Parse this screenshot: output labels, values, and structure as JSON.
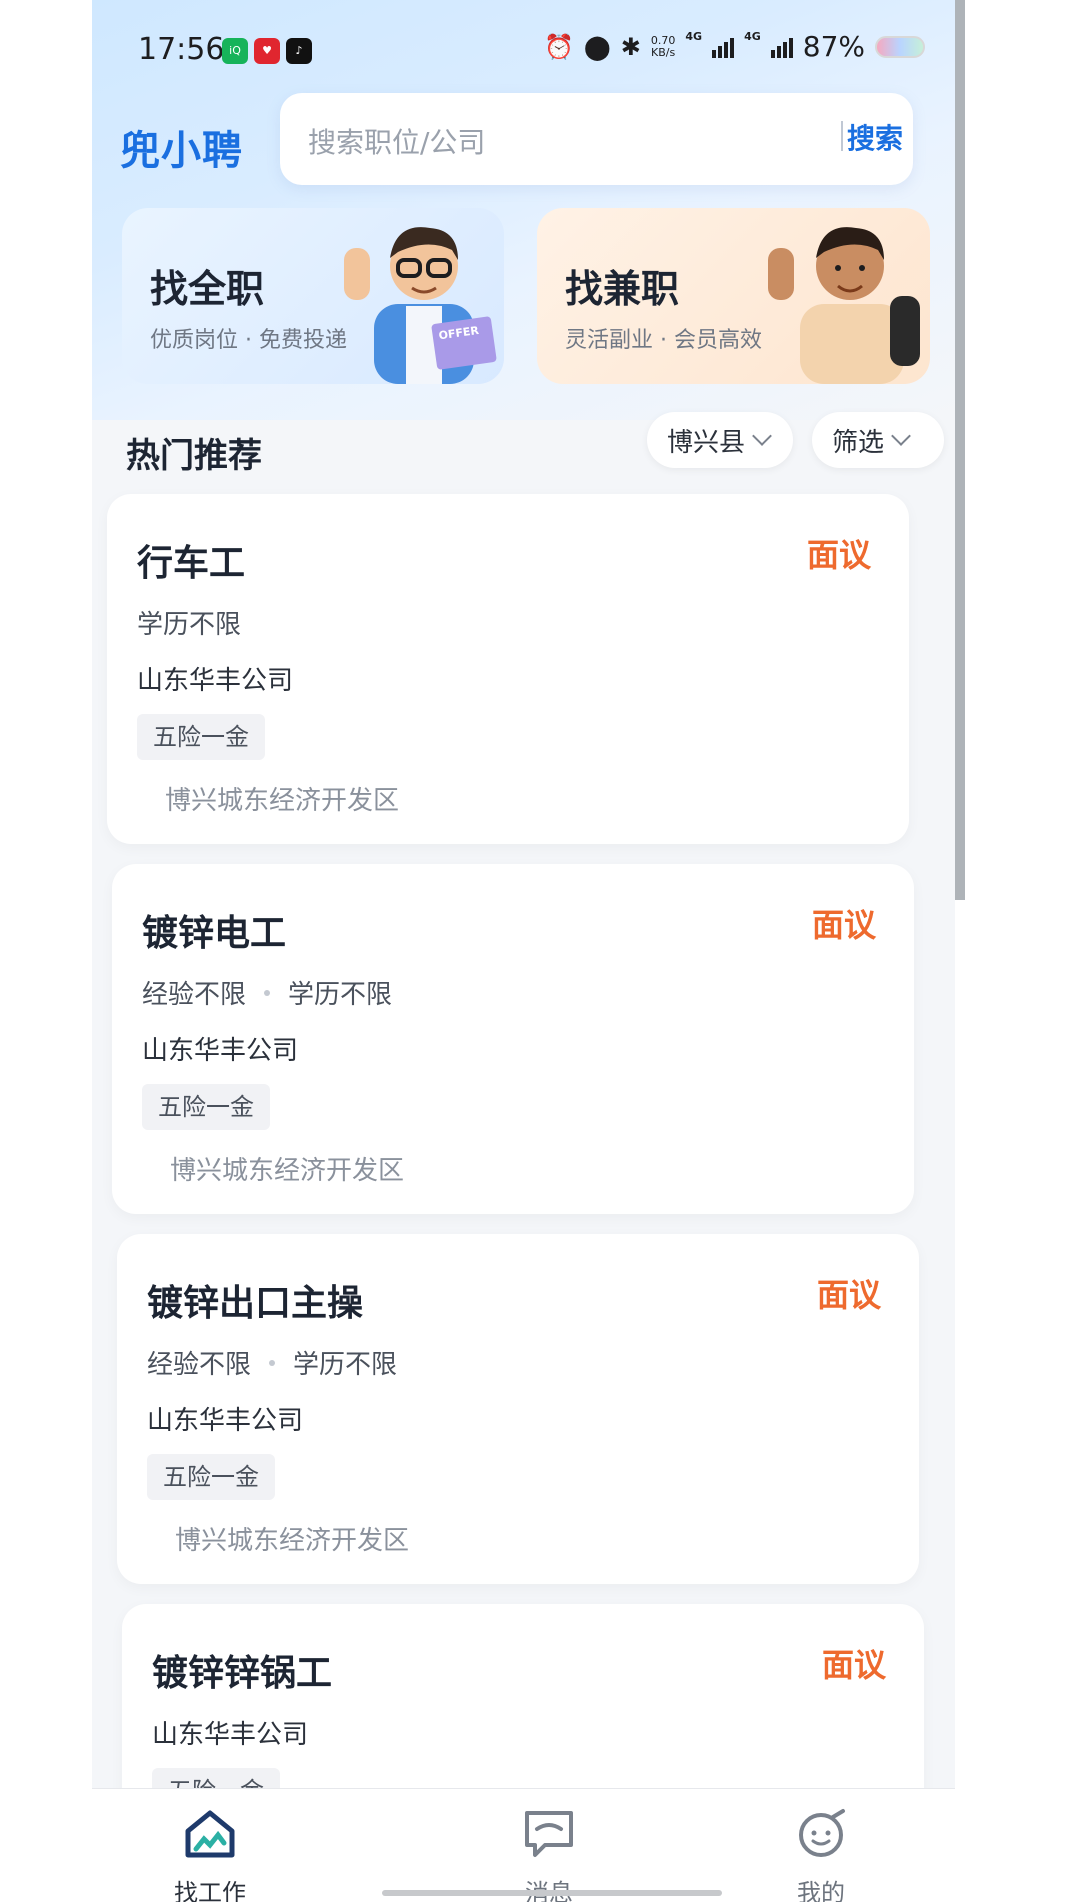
{
  "status_bar": {
    "time": "17:56",
    "app_icons": [
      "iqiyi-icon",
      "red-app-icon",
      "tiktok-icon"
    ],
    "speed_value": "0.70",
    "speed_unit": "KB/s",
    "network_1": "4G",
    "network_2": "4G",
    "battery": "87%"
  },
  "header": {
    "brand": "兜小聘",
    "search": {
      "placeholder": "搜索职位/公司",
      "button": "搜索"
    }
  },
  "categories": [
    {
      "title": "找全职",
      "subtitle": "优质岗位 · 免费投递"
    },
    {
      "title": "找兼职",
      "subtitle": "灵活副业 · 会员高效"
    }
  ],
  "section": {
    "title": "热门推荐",
    "region_filter": "博兴县",
    "filter": "筛选"
  },
  "jobs": [
    {
      "title": "行车工",
      "salary": "面议",
      "requirements": [
        "学历不限"
      ],
      "company": "山东华丰公司",
      "tag": "五险一金",
      "location": "博兴城东经济开发区"
    },
    {
      "title": "镀锌电工",
      "salary": "面议",
      "requirements": [
        "经验不限",
        "学历不限"
      ],
      "company": "山东华丰公司",
      "tag": "五险一金",
      "location": "博兴城东经济开发区"
    },
    {
      "title": "镀锌出口主操",
      "salary": "面议",
      "requirements": [
        "经验不限",
        "学历不限"
      ],
      "company": "山东华丰公司",
      "tag": "五险一金",
      "location": "博兴城东经济开发区"
    },
    {
      "title": "镀锌锌锅工",
      "salary": "面议",
      "company": "山东华丰公司",
      "tag": "五险一金"
    }
  ],
  "nav": [
    {
      "label": "找工作",
      "icon": "home-work-icon",
      "active": true
    },
    {
      "label": "消息",
      "icon": "message-icon",
      "active": false
    },
    {
      "label": "我的",
      "icon": "profile-icon",
      "active": false
    }
  ],
  "colors": {
    "brand": "#1a6fe0",
    "salary": "#ee6a2e",
    "nav_active": "#1e3a6b"
  }
}
